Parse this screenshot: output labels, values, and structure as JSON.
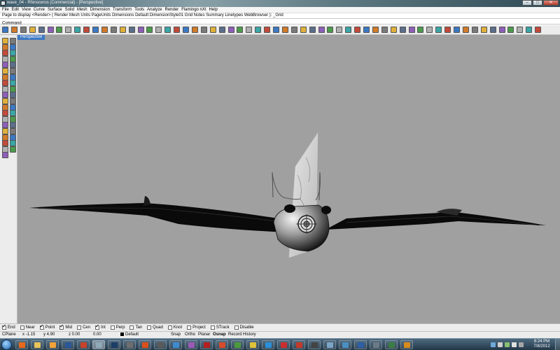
{
  "window": {
    "title": "wave_04 - Rhinoceros (Commercial) - [Perspective]",
    "controls": [
      "–",
      "□",
      "✕"
    ]
  },
  "menubar": {
    "items": [
      "File",
      "Edit",
      "View",
      "Curve",
      "Surface",
      "Solid",
      "Mesh",
      "Dimension",
      "Transform",
      "Tools",
      "Analyze",
      "Render",
      "Flamingo nXt",
      "Help"
    ]
  },
  "command_history": "Page to display <Render> ( Render  Mesh  Units  PageUnits  Dimensions  Default  DimensionStyle01  Grid  Notes  Summary  Linetypes  WebBrowser ): _Grid",
  "command_prompt": {
    "label": "Command",
    "value": ""
  },
  "main_toolbar": {
    "icons": [
      "new-icon",
      "open-icon",
      "save-icon",
      "print-icon",
      "import-icon",
      "cut-icon",
      "copy-icon",
      "paste-icon",
      "undo-icon",
      "pan-icon",
      "rotate-view-icon",
      "zoom-icon",
      "zoom-window-icon",
      "zoom-extents-icon",
      "zoom-selected-icon",
      "undo-view-icon",
      "four-views-icon",
      "cplane-icon",
      "grid-icon",
      "select-all-icon",
      "object-props-icon",
      "hide-icon",
      "lock-icon",
      "layer-icon",
      "render-icon",
      "material-icon",
      "sun-icon",
      "wireframe-icon",
      "shaded-icon",
      "rendered-preview-icon",
      "ghosted-icon",
      "xray-icon",
      "dimension-icon",
      "text-icon",
      "help-icon",
      "camera-icon",
      "sphere-icon",
      "flamingo-render-icon",
      "flamingo-material-icon",
      "environment-icon",
      "lights-icon",
      "plant-icon",
      "decal-icon",
      "ground-plane-icon",
      "options-icon",
      "toolbar-layout-icon",
      "script-icon",
      "analyze-icon",
      "curvature-icon",
      "zebra-icon",
      "emap-icon",
      "draft-angle-icon",
      "edge-tools-icon",
      "mesh-icon",
      "surface-tools-icon",
      "transform-icon",
      "array-icon",
      "boolean-icon",
      "osnap-icon",
      "grasshopper-icon"
    ]
  },
  "left_toolbar": {
    "icons": [
      "select-icon",
      "point-icon",
      "polyline-icon",
      "curve-icon",
      "circle-icon",
      "arc-icon",
      "ellipse-icon",
      "polygon-icon",
      "rectangle-icon",
      "free-curve-icon",
      "fillet-curve-icon",
      "offset-curve-icon",
      "surface-corner-icon",
      "loft-icon",
      "extrude-icon",
      "revolve-icon",
      "solid-box-icon",
      "sphere-solid-icon",
      "mesh-tools-icon",
      "cylinder-icon",
      "lightbulb-icon",
      "text-object-icon",
      "trim-icon",
      "split-icon",
      "join-icon",
      "explode-icon",
      "move-icon",
      "copy-object-icon",
      "rotate-icon",
      "scale-icon",
      "mirror-icon",
      "array-object-icon",
      "boolean-union-icon",
      "analyze-direction-icon",
      "group-icon",
      "ungroup-icon",
      "block-icon",
      "dimension-linear-icon",
      "hatch-icon"
    ]
  },
  "viewport": {
    "tab_label": "Perspective",
    "background": "#a0a0a0"
  },
  "osnap": {
    "items": [
      {
        "label": "End",
        "checked": true
      },
      {
        "label": "Near",
        "checked": false
      },
      {
        "label": "Point",
        "checked": true
      },
      {
        "label": "Mid",
        "checked": true
      },
      {
        "label": "Cen",
        "checked": false
      },
      {
        "label": "Int",
        "checked": true
      },
      {
        "label": "Perp",
        "checked": false
      },
      {
        "label": "Tan",
        "checked": false
      },
      {
        "label": "Quad",
        "checked": false
      },
      {
        "label": "Knot",
        "checked": false
      },
      {
        "label": "Project",
        "checked": false
      },
      {
        "label": "STrack",
        "checked": false
      },
      {
        "label": "Disable",
        "checked": false
      }
    ]
  },
  "status": {
    "cplane": "CPlane",
    "x": "x -1.15",
    "y": "y 4.90",
    "z": "z 0.00",
    "distance": "0.00",
    "layer": "Default",
    "snap": "Snap",
    "ortho": "Ortho",
    "planar": "Planar",
    "osnap": "Osnap",
    "record_history": "Record History"
  },
  "taskbar": {
    "apps": [
      {
        "name": "firefox-icon",
        "color": "#e66a1c"
      },
      {
        "name": "explorer-folder-icon",
        "color": "#e8c35a"
      },
      {
        "name": "media-player-icon",
        "color": "#f2a23a"
      },
      {
        "name": "word-icon",
        "color": "#2b5797"
      },
      {
        "name": "powerpoint-icon",
        "color": "#c7432a"
      },
      {
        "name": "rhino-icon",
        "color": "#8fa9b8"
      },
      {
        "name": "photoshop-icon",
        "color": "#1b3d66"
      },
      {
        "name": "zbrush-icon",
        "color": "#6e6e6e"
      },
      {
        "name": "firefox-window-icon",
        "color": "#d94f1a"
      },
      {
        "name": "sketchbook-icon",
        "color": "#5a5a5a"
      },
      {
        "name": "alias-icon",
        "color": "#3f8bd0"
      },
      {
        "name": "itunes-icon",
        "color": "#9b59b6"
      },
      {
        "name": "acrobat-icon",
        "color": "#b61f1f"
      },
      {
        "name": "pdf-icon",
        "color": "#d64b2b"
      },
      {
        "name": "greenhouse-icon",
        "color": "#4d9a3d"
      },
      {
        "name": "chrome-icon",
        "color": "#e0c23a"
      },
      {
        "name": "skype-icon",
        "color": "#2a8fd8"
      },
      {
        "name": "keyshot-icon",
        "color": "#cc2d2d"
      },
      {
        "name": "solidworks-icon",
        "color": "#c23a2a"
      },
      {
        "name": "recorder-icon",
        "color": "#444444"
      },
      {
        "name": "notepad-icon",
        "color": "#7aa5c6"
      },
      {
        "name": "control-panel-icon",
        "color": "#4a90c2"
      },
      {
        "name": "eye-icon",
        "color": "#2c5fa3"
      },
      {
        "name": "calculator-icon",
        "color": "#6c7a86"
      },
      {
        "name": "camera-app-icon",
        "color": "#3a7d44"
      },
      {
        "name": "inventor-icon",
        "color": "#d98a1e"
      }
    ],
    "clock_time": "8:24 PM",
    "clock_date": "7/8/2012"
  }
}
